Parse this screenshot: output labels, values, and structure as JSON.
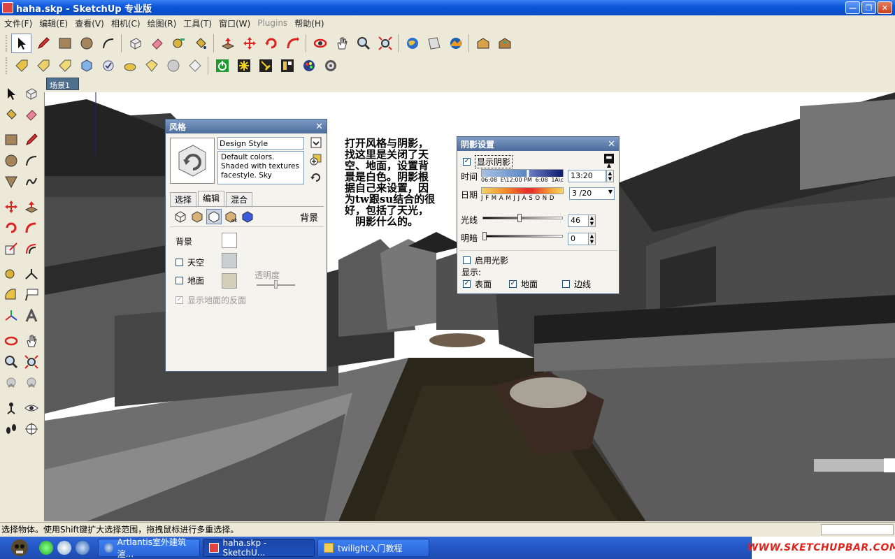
{
  "window": {
    "title": "haha.skp - SketchUp 专业版"
  },
  "menu": [
    {
      "label": "文件(F)",
      "dim": false
    },
    {
      "label": "编辑(E)",
      "dim": false
    },
    {
      "label": "查看(V)",
      "dim": false
    },
    {
      "label": "相机(C)",
      "dim": false
    },
    {
      "label": "绘图(R)",
      "dim": false
    },
    {
      "label": "工具(T)",
      "dim": false
    },
    {
      "label": "窗口(W)",
      "dim": false
    },
    {
      "label": "Plugins",
      "dim": true
    },
    {
      "label": "帮助(H)",
      "dim": false
    }
  ],
  "scene_tab": "场景1",
  "annotation": "打开风格与阴影，\n找这里是关闭了天\n空、地面，设置背\n景是白色。阴影根\n据自己来设置，因\n为tw跟su结合的很\n好，包括了天光，\n　阴影什么的。",
  "style_panel": {
    "title": "风格",
    "style_name": "Design Style",
    "description": "Default colors.  Shaded with textures facestyle.  Sky",
    "tabs": [
      "选择",
      "编辑",
      "混合"
    ],
    "selected_tab": 1,
    "section_title": "背景",
    "background_label": "背景",
    "sky_label": "天空",
    "ground_label": "地面",
    "transparency_label": "透明度",
    "show_ground_back_label": "显示地面的反面",
    "colors": {
      "background": "#ffffff",
      "sky": "#c8d0d2",
      "ground": "#d4cfb8"
    }
  },
  "shadow_panel": {
    "title": "阴影设置",
    "show_shadows_label": "显示阴影",
    "time_label": "时间",
    "time_sunrise": "06:08",
    "time_noon": "E\\12:00 PM",
    "time_sunset": "6:08",
    "time_evening": "1A\\c",
    "time_value": "13:20",
    "date_label": "日期",
    "months": "J F M A M J J A S O N D",
    "date_value": "3 /20",
    "light_label": "光线",
    "light_value": "46",
    "dark_label": "明暗",
    "dark_value": "0",
    "use_sun_label": "启用光影",
    "display_label": "显示:",
    "faces_label": "表面",
    "ground_label": "地面",
    "edges_label": "边线",
    "light_level": 0.46,
    "dark_level": 0.0
  },
  "status_text": "选择物体。使用Shift键扩大选择范围，拖拽鼠标进行多重选择。",
  "taskbar": {
    "tasks": [
      "Artlantis室外建筑渲...",
      "haha.skp - SketchU...",
      "twilight入门教程"
    ],
    "tray_logo": "WWW.SKETCHUPBAR.COM"
  }
}
